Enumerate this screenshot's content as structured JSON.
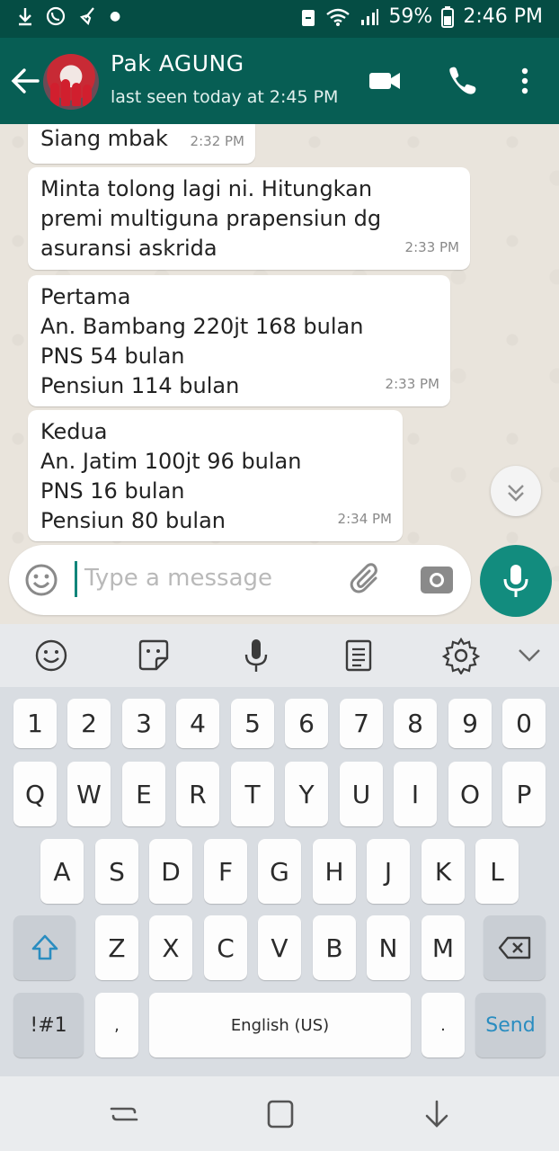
{
  "status_bar": {
    "battery": "59%",
    "time": "2:46 PM"
  },
  "header": {
    "contact_name": "Pak AGUNG",
    "last_seen": "last seen today at 2:45 PM"
  },
  "messages": [
    {
      "lines": [
        "Siang mbak"
      ],
      "time": "2:32 PM"
    },
    {
      "lines": [
        "Minta tolong lagi ni. Hitungkan",
        "premi multiguna prapensiun dg",
        "asuransi askrida"
      ],
      "time": "2:33 PM"
    },
    {
      "lines": [
        "Pertama",
        "An. Bambang 220jt 168 bulan",
        "PNS 54 bulan",
        "Pensiun 114 bulan"
      ],
      "time": "2:33 PM"
    },
    {
      "lines": [
        "Kedua",
        "An. Jatim 100jt 96 bulan",
        "PNS 16 bulan",
        "Pensiun 80 bulan"
      ],
      "time": "2:34 PM"
    }
  ],
  "composer": {
    "placeholder": "Type a message"
  },
  "keyboard": {
    "number_row": [
      "1",
      "2",
      "3",
      "4",
      "5",
      "6",
      "7",
      "8",
      "9",
      "0"
    ],
    "row1": [
      "Q",
      "W",
      "E",
      "R",
      "T",
      "Y",
      "U",
      "I",
      "O",
      "P"
    ],
    "row2": [
      "A",
      "S",
      "D",
      "F",
      "G",
      "H",
      "J",
      "K",
      "L"
    ],
    "row3": [
      "Z",
      "X",
      "C",
      "V",
      "B",
      "N",
      "M"
    ],
    "symbols_label": "!#1",
    "comma": ",",
    "space_label": "English (US)",
    "period": ".",
    "send_label": "Send"
  },
  "colors": {
    "header": "#075e54",
    "statusbar": "#054d44",
    "accent": "#128c7e",
    "send_text": "#2a8dc0"
  }
}
